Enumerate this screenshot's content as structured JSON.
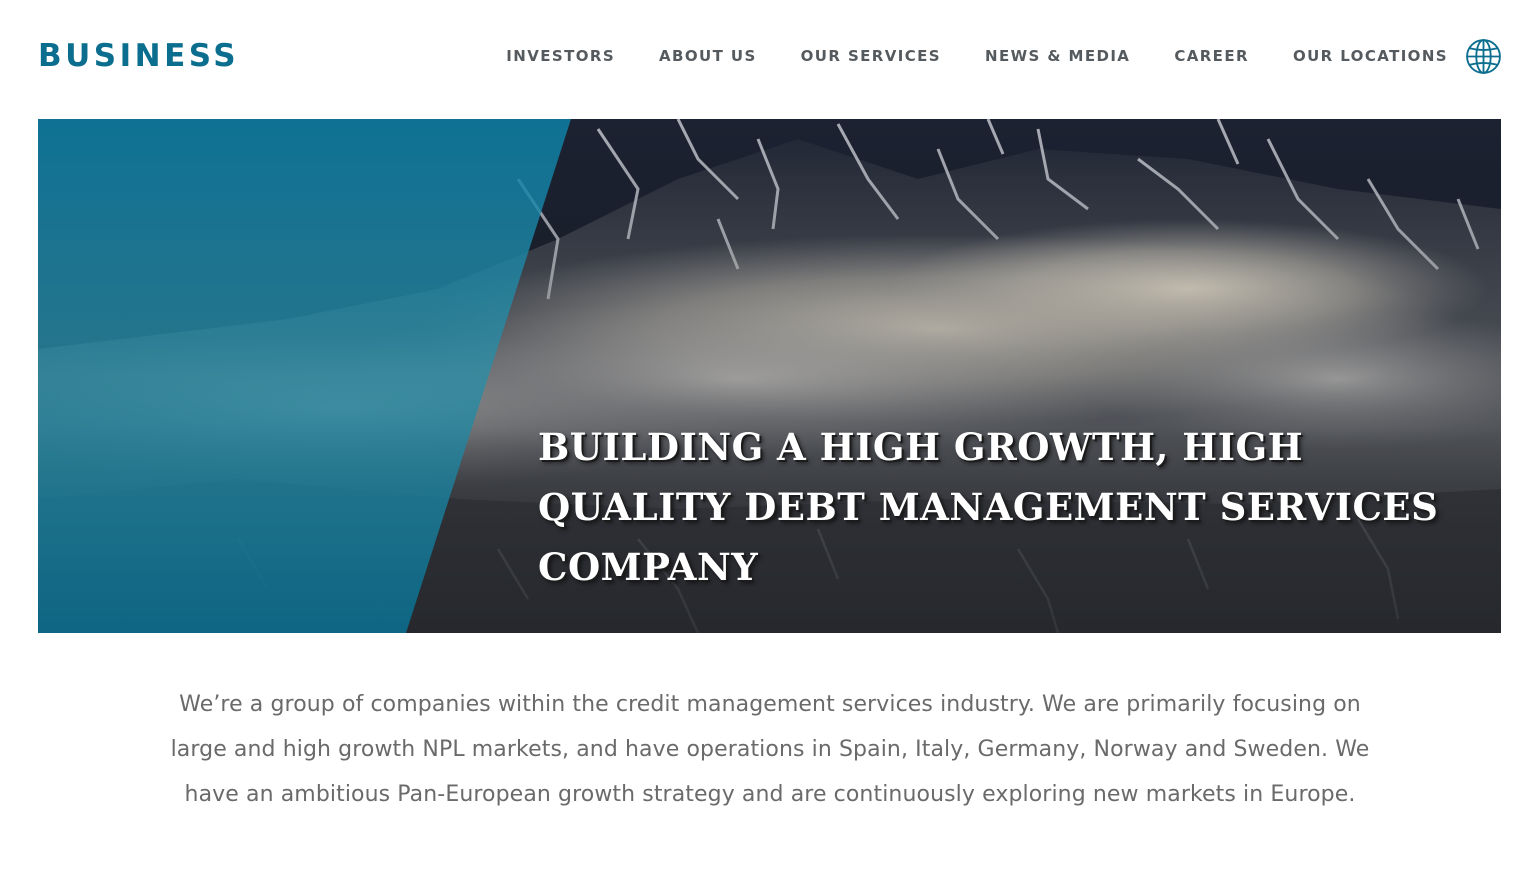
{
  "header": {
    "logo": "BUSINESS",
    "nav": [
      "INVESTORS",
      "ABOUT US",
      "OUR SERVICES",
      "NEWS & MEDIA",
      "CAREER",
      "OUR LOCATIONS"
    ],
    "language_icon": "globe-icon"
  },
  "hero": {
    "title": "BUILDING A HIGH GROWTH, HIGH QUALITY DEBT MANAGEMENT SERVICES COMPANY"
  },
  "intro": {
    "text": "We’re a group of companies within the credit management services industry. We are primarily focusing on large and high growth NPL markets, and have operations in Spain, Italy, Germany, Norway and Sweden. We have an ambitious Pan-European growth strategy and are continuously exploring new markets in Europe."
  },
  "colors": {
    "brand": "#0b6e8f",
    "nav_text": "#555a5e",
    "body_text": "#6a6a6a"
  }
}
